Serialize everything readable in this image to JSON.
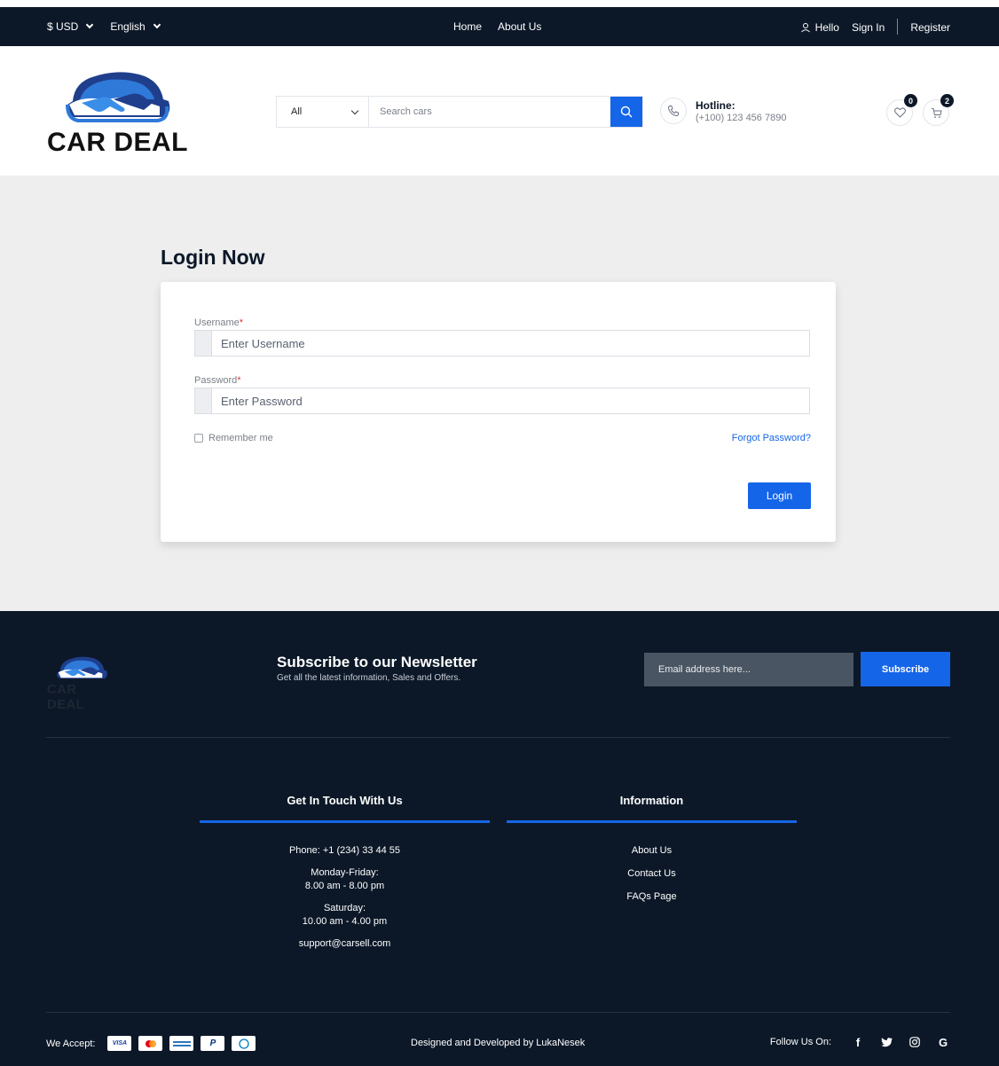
{
  "topbar": {
    "currency": "$ USD",
    "language": "English",
    "nav": [
      "Home",
      "About Us"
    ],
    "greeting": "Hello",
    "sign_in": "Sign In",
    "register": "Register"
  },
  "header": {
    "logo_text": "CAR DEAL",
    "search": {
      "category": "All",
      "placeholder": "Search cars"
    },
    "hotline": {
      "label": "Hotline:",
      "number": "(+100) 123 456 7890"
    },
    "wishlist_count": "0",
    "cart_count": "2"
  },
  "login": {
    "title": "Login Now",
    "username_label": "Username",
    "username_placeholder": "Enter Username",
    "password_label": "Password",
    "password_placeholder": "Enter Password",
    "required_mark": "*",
    "remember": "Remember me",
    "forgot": "Forgot Password?",
    "submit": "Login"
  },
  "footer": {
    "logo_text": "CAR DEAL",
    "newsletter_title": "Subscribe to our Newsletter",
    "newsletter_sub": "Get all the latest information, Sales and Offers.",
    "email_placeholder": "Email address here...",
    "subscribe": "Subscribe",
    "contact": {
      "title": "Get In Touch With Us",
      "phone": "Phone: +1 (234) 33 44 55",
      "weekday_label": "Monday-Friday:",
      "weekday_hours": "8.00 am - 8.00 pm",
      "saturday_label": "Saturday:",
      "saturday_hours": "10.00 am - 4.00 pm",
      "email": "support@carsell.com"
    },
    "information": {
      "title": "Information",
      "links": [
        "About Us",
        "Contact Us",
        "FAQs Page"
      ]
    },
    "we_accept": "We Accept:",
    "payment_methods": [
      "VISA",
      "mastercard",
      "american-express",
      "paypal",
      "diners-club"
    ],
    "credit": "Designed and Developed by LukaNesek",
    "follow": "Follow Us On:",
    "socials": [
      "facebook",
      "twitter",
      "instagram",
      "google"
    ]
  },
  "colors": {
    "navy": "#0c1828",
    "accent": "#1565e8",
    "page_bg": "#eeeeee"
  }
}
